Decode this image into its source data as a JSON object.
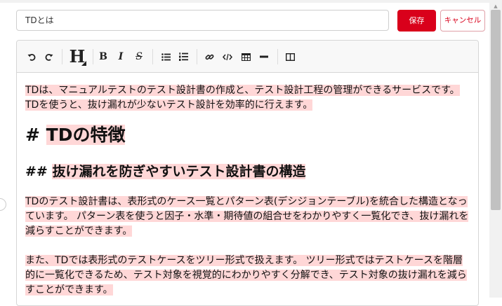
{
  "header": {
    "title_value": "TDとは",
    "save_label": "保存",
    "cancel_label": "キャンセル"
  },
  "toolbar": {
    "items": [
      "undo-icon",
      "redo-icon",
      "heading-icon",
      "bold-icon",
      "italic-icon",
      "strikethrough-icon",
      "bullet-list-icon",
      "numbered-list-icon",
      "link-icon",
      "code-icon",
      "table-icon",
      "horizontal-rule-icon",
      "side-by-side-icon"
    ],
    "bold_glyph": "B",
    "italic_glyph": "I",
    "strike_glyph": "S",
    "heading_glyph": "H"
  },
  "content": {
    "p1": "TDは、マニュアルテストのテスト設計書の作成と、テスト設計工程の管理ができるサービスです。 TDを使うと、抜け漏れが少ないテスト設計を効率的に行えます。",
    "h1_marker": "# ",
    "h1_text": "TDの特徴",
    "h2_marker": "## ",
    "h2_text": "抜け漏れを防ぎやすいテスト設計書の構造",
    "p2": "TDのテスト設計書は、表形式のケース一覧とパターン表(デシジョンテーブル)を統合した構造となっています。 パターン表を使うと因子・水準・期待値の組合せをわかりやすく一覧化でき、抜け漏れを減らすことができます。",
    "p3": "また、TDでは表形式のテストケースをツリー形式で扱えます。 ツリー形式ではテストケースを階層的に一覧化できるため、テスト対象を視覚的にわかりやすく分解でき、テスト対象の抜け漏れを減らすことができます。"
  },
  "colors": {
    "accent": "#d9001b",
    "highlight": "#ffd7d7"
  }
}
